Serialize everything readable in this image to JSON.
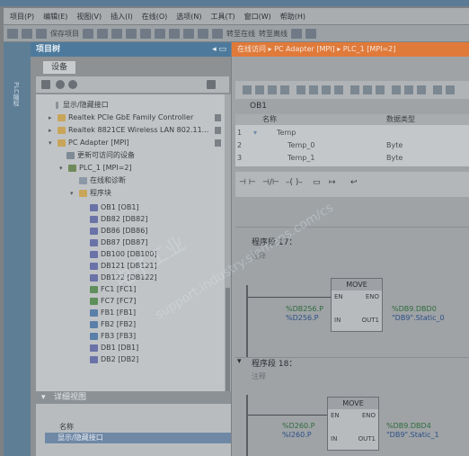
{
  "menu": [
    "项目(P)",
    "编辑(E)",
    "视图(V)",
    "插入(I)",
    "在线(O)",
    "选项(N)",
    "工具(T)",
    "窗口(W)",
    "帮助(H)"
  ],
  "toolbar": {
    "save_label": "保存项目",
    "online_label": "转至在线",
    "offline_label": "转至离线"
  },
  "left_strip_label": "PLC编程",
  "project_tree": {
    "title": "项目树",
    "devices_tab": "设备",
    "items": [
      {
        "label": "显示/隐藏接口"
      },
      {
        "label": "Realtek PCIe GbE Family Controller"
      },
      {
        "label": "Realtek 8821CE Wireless LAN 802.11..."
      },
      {
        "label": "PC Adapter [MPI]"
      },
      {
        "label": "更新可访问的设备"
      },
      {
        "label": "PLC_1 [MPI=2]"
      },
      {
        "label": "在线和诊断"
      },
      {
        "label": "程序块"
      },
      {
        "label": "OB1 [OB1]"
      },
      {
        "label": "DB82 [DB82]"
      },
      {
        "label": "DB86 [DB86]"
      },
      {
        "label": "DB87 [DB87]"
      },
      {
        "label": "DB100 [DB100]"
      },
      {
        "label": "DB121 [DB121]"
      },
      {
        "label": "DB122 [DB122]"
      },
      {
        "label": "FC1 [FC1]"
      },
      {
        "label": "FC7 [FC7]"
      },
      {
        "label": "FB1 [FB1]"
      },
      {
        "label": "FB2 [FB2]"
      },
      {
        "label": "FB3 [FB3]"
      },
      {
        "label": "DB1 [DB1]"
      },
      {
        "label": "DB2 [DB2]"
      }
    ]
  },
  "detail_view": {
    "title": "详细视图",
    "col_name": "名称",
    "row": "显示/隐藏接口"
  },
  "editor": {
    "breadcrumb": "在线访问 ▸ PC Adapter [MPI] ▸ PLC_1 [MPI=2]",
    "block_name": "OB1",
    "interface": {
      "col_name": "名称",
      "col_type": "数据类型",
      "rows": [
        {
          "num": "1",
          "name": "Temp",
          "type": ""
        },
        {
          "num": "2",
          "name": "Temp_0",
          "type": "Byte"
        },
        {
          "num": "3",
          "name": "Temp_1",
          "type": "Byte"
        }
      ]
    },
    "networks": [
      {
        "title": "程序段 17：",
        "comment": "注释",
        "box": "MOVE",
        "en": "EN",
        "eno": "ENO",
        "in": "IN",
        "out": "OUT1",
        "in_addr": "%DB256.P",
        "in_sym": "%D256.P",
        "out_addr": "%DB9.DBD0",
        "out_sym": "\"DB9\".Static_0"
      },
      {
        "title": "程序段 18：",
        "comment": "注释",
        "box": "MOVE",
        "en": "EN",
        "eno": "ENO",
        "in": "IN",
        "out": "OUT1",
        "in_addr": "%D260.P",
        "in_sym": "%I260.P",
        "out_addr": "%DB9.DBD4",
        "out_sym": "\"DB9\".Static_1"
      }
    ]
  },
  "watermark": [
    "电子工业",
    "support.industry.siemens.com/cs"
  ]
}
